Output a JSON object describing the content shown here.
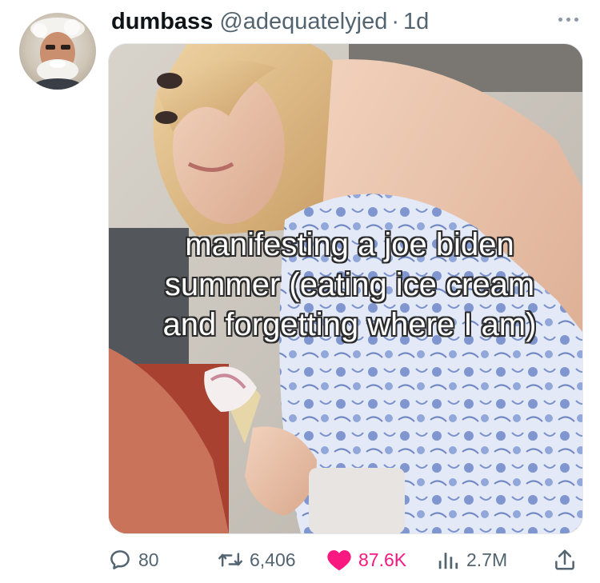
{
  "tweet": {
    "display_name": "dumbass",
    "handle": "@adequatelyjed",
    "separator": "·",
    "time": "1d",
    "image_caption_lines": [
      "manifesting a joe biden",
      "summer (eating ice cream",
      "and forgetting where I am)"
    ]
  },
  "actions": {
    "replies": "80",
    "reposts": "6,406",
    "likes": "87.6K",
    "views": "2.7M"
  },
  "icons": {
    "reply": "reply-bubble-icon",
    "repost": "repost-arrows-icon",
    "like": "heart-filled-icon",
    "views": "bar-chart-icon",
    "share": "share-upload-icon",
    "more": "more-dots-icon"
  },
  "colors": {
    "text_primary": "#0f1419",
    "text_secondary": "#536471",
    "like_pink": "#f91880"
  }
}
